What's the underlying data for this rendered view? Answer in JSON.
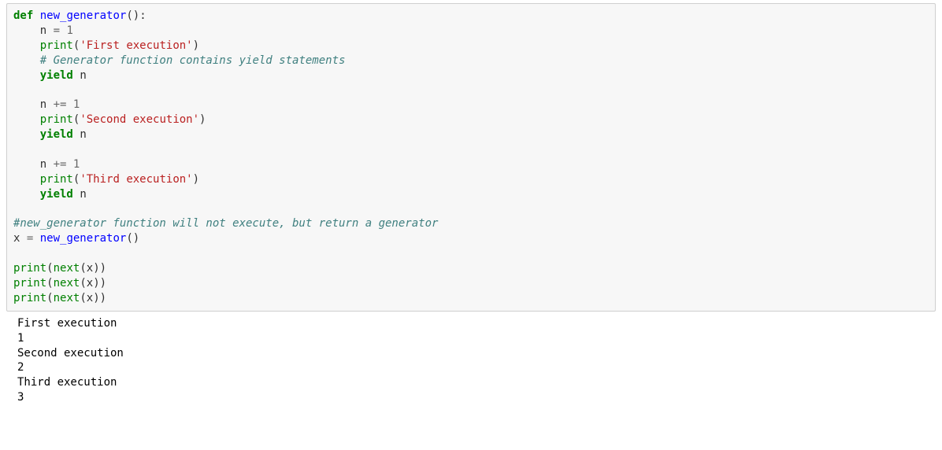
{
  "code": {
    "kw_def": "def",
    "fn_name": "new_generator",
    "paren_open": "(",
    "paren_close": ")",
    "colon": ":",
    "indent1": "    ",
    "var_n": "n",
    "op_assign": " = ",
    "num_1": "1",
    "builtin_print": "print",
    "str_first": "'First execution'",
    "cmt_yield": "# Generator function contains yield statements",
    "kw_yield": "yield",
    "space": " ",
    "op_plus_eq": " += ",
    "str_second": "'Second execution'",
    "str_third": "'Third execution'",
    "cmt_gen": "#new_generator function will not execute, but return a generator",
    "var_x": "x",
    "builtin_next": "next"
  },
  "output": {
    "line1": "First execution",
    "line2": "1",
    "line3": "Second execution",
    "line4": "2",
    "line5": "Third execution",
    "line6": "3"
  }
}
